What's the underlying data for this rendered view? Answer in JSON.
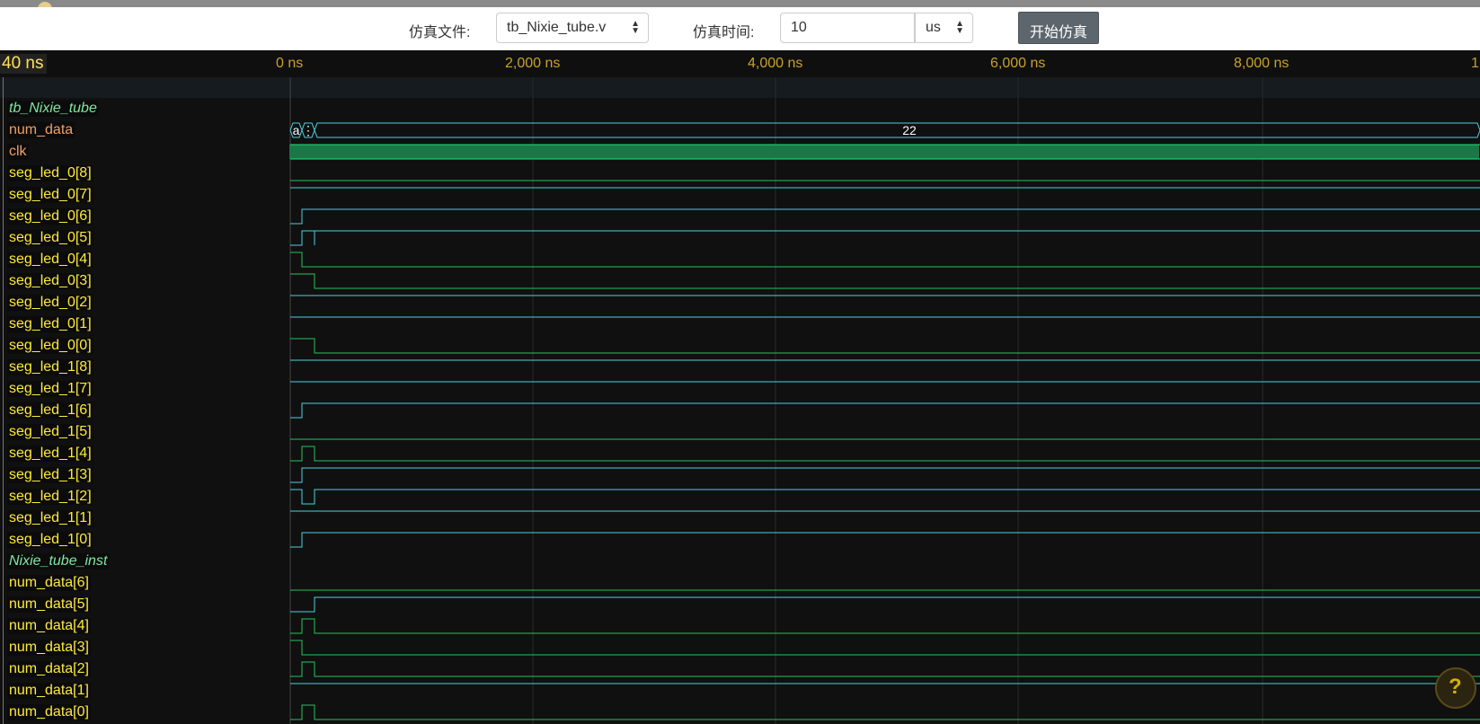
{
  "toolbar": {
    "file_label": "仿真文件:",
    "file_value": "tb_Nixie_tube.v",
    "time_label": "仿真时间:",
    "time_value": "10",
    "unit_value": "us",
    "start_button": "开始仿真"
  },
  "ruler": {
    "cursor_time": "40 ns",
    "ticks": [
      "0 ns",
      "2,000 ns",
      "4,000 ns",
      "6,000 ns",
      "8,000 ns",
      "1"
    ]
  },
  "signals": [
    {
      "label": "tb_Nixie_tube",
      "kind": "scope"
    },
    {
      "label": "num_data",
      "kind": "bus",
      "values": [
        "a",
        "⋮",
        "22"
      ]
    },
    {
      "label": "clk",
      "kind": "clock"
    },
    {
      "label": "seg_led_0[8]",
      "kind": "bit"
    },
    {
      "label": "seg_led_0[7]",
      "kind": "bit"
    },
    {
      "label": "seg_led_0[6]",
      "kind": "bit"
    },
    {
      "label": "seg_led_0[5]",
      "kind": "bit"
    },
    {
      "label": "seg_led_0[4]",
      "kind": "bit"
    },
    {
      "label": "seg_led_0[3]",
      "kind": "bit"
    },
    {
      "label": "seg_led_0[2]",
      "kind": "bit"
    },
    {
      "label": "seg_led_0[1]",
      "kind": "bit"
    },
    {
      "label": "seg_led_0[0]",
      "kind": "bit"
    },
    {
      "label": "seg_led_1[8]",
      "kind": "bit"
    },
    {
      "label": "seg_led_1[7]",
      "kind": "bit"
    },
    {
      "label": "seg_led_1[6]",
      "kind": "bit"
    },
    {
      "label": "seg_led_1[5]",
      "kind": "bit"
    },
    {
      "label": "seg_led_1[4]",
      "kind": "bit"
    },
    {
      "label": "seg_led_1[3]",
      "kind": "bit"
    },
    {
      "label": "seg_led_1[2]",
      "kind": "bit"
    },
    {
      "label": "seg_led_1[1]",
      "kind": "bit"
    },
    {
      "label": "seg_led_1[0]",
      "kind": "bit"
    },
    {
      "label": "Nixie_tube_inst",
      "kind": "scope"
    },
    {
      "label": "num_data[6]",
      "kind": "bit"
    },
    {
      "label": "num_data[5]",
      "kind": "bit"
    },
    {
      "label": "num_data[4]",
      "kind": "bit"
    },
    {
      "label": "num_data[3]",
      "kind": "bit"
    },
    {
      "label": "num_data[2]",
      "kind": "bit"
    },
    {
      "label": "num_data[1]",
      "kind": "bit"
    },
    {
      "label": "num_data[0]",
      "kind": "bit"
    }
  ],
  "colors": {
    "high": "#4dd0e1",
    "low": "#22c55e",
    "clock": "#22e07a",
    "tick": "#c9a227",
    "name": "#ffeb3b"
  },
  "help_icon": "?"
}
